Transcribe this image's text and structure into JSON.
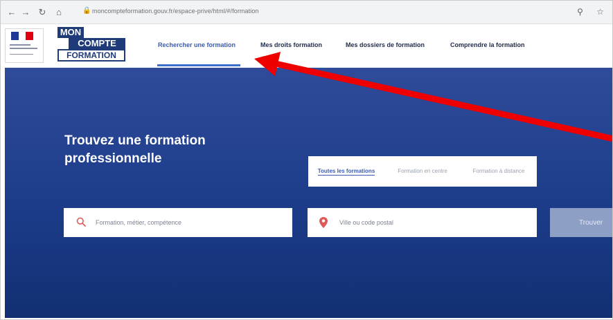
{
  "browser": {
    "url": "moncompteformation.gouv.fr/espace-prive/html/#/formation",
    "icons": [
      "back-icon",
      "forward-icon",
      "reload-icon",
      "home-icon",
      "lock-icon",
      "key-icon",
      "star-icon"
    ]
  },
  "header": {
    "logo": {
      "line1": "MON",
      "line2": "COMPTE",
      "line3": "FORMATION"
    },
    "nav": [
      {
        "label": "Rechercher une formation",
        "active": true
      },
      {
        "label": "Mes droits formation",
        "active": false
      },
      {
        "label": "Mes dossiers de formation",
        "active": false
      },
      {
        "label": "Comprendre la formation",
        "active": false
      }
    ]
  },
  "hero": {
    "title_line1": "Trouvez une formation",
    "title_line2": "professionnelle"
  },
  "tabs": [
    {
      "label": "Toutes les formations",
      "active": true
    },
    {
      "label": "Formation en centre",
      "active": false
    },
    {
      "label": "Formation à distance",
      "active": false
    }
  ],
  "search": {
    "query_placeholder": "Formation, métier, compétence",
    "location_placeholder": "Ville ou code postal",
    "button_label": "Trouver"
  },
  "colors": {
    "brand_navy": "#1e3a78",
    "hero_top": "#2f4b9a",
    "hero_bottom": "#132f72",
    "active_link": "#3a5bb0",
    "icon_red": "#e05a5a",
    "annotation_arrow": "#ee0000"
  }
}
